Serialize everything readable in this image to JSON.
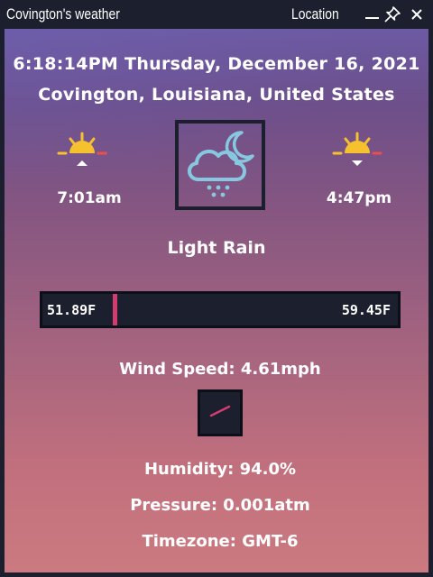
{
  "window": {
    "title": "Covington's weather",
    "location_label": "Location",
    "controls": [
      "minimize-icon",
      "pin-icon",
      "close-icon"
    ]
  },
  "datetime": "6:18:14PM Thursday, December 16, 2021",
  "place": "Covington, Louisiana, United States",
  "sunrise": {
    "time": "7:01am",
    "icon": "sunrise-icon"
  },
  "sunset": {
    "time": "4:47pm",
    "icon": "sunset-icon"
  },
  "weather": {
    "icon": "night-rain-cloud-icon",
    "condition": "Light Rain"
  },
  "temperature": {
    "low": "51.89F",
    "high": "59.45F",
    "current_marker_color": "#d23c6e"
  },
  "wind": {
    "label": "Wind Speed: 4.61mph",
    "icon": "wind-direction-icon"
  },
  "humidity": "Humidity: 94.0%",
  "pressure": "Pressure: 0.001atm",
  "timezone": "Timezone: GMT-6",
  "colors": {
    "frame": "#1c1f2e",
    "sun": "#f5c12e",
    "sun_ray_accent": "#e8504c",
    "cloud": "#87c8e0",
    "text": "#ffffff"
  }
}
